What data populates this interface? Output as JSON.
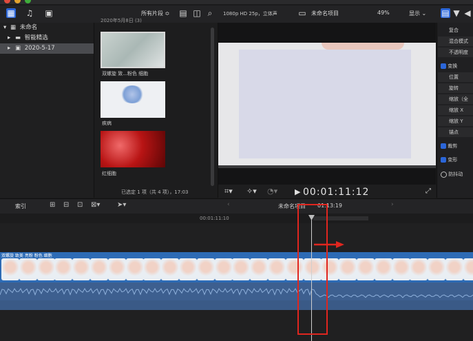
{
  "toolbar": {
    "filter_label": "所有片段 ≎",
    "viewer_format": "1080p HD 25p，立体声",
    "project_name": "未命名项目",
    "zoom": "49%",
    "display_menu": "显示 ⌄"
  },
  "library": {
    "name": "未命名",
    "items": [
      {
        "label": "智能精选"
      },
      {
        "label": "2020-5-17"
      }
    ]
  },
  "browser": {
    "date_header": "2020年5月8日 (3)",
    "clips": [
      {
        "caption": "双螺旋 致...粉色 细胞"
      },
      {
        "caption": "疾病"
      },
      {
        "caption": "红细胞"
      }
    ],
    "status": "已选定 1 项（共 4 项），17:03"
  },
  "viewer": {
    "timecode": "00:01:11:12"
  },
  "inspector": {
    "rows": [
      {
        "label": "复合"
      },
      {
        "label": "混合模式"
      },
      {
        "label": "不透明度"
      },
      {
        "label": "变换"
      },
      {
        "label": "位置"
      },
      {
        "label": "旋转"
      },
      {
        "label": "缩放（全"
      },
      {
        "label": "缩放 X"
      },
      {
        "label": "缩放 Y"
      },
      {
        "label": "锚点"
      },
      {
        "label": "裁剪"
      },
      {
        "label": "变形"
      },
      {
        "label": "防抖动"
      }
    ]
  },
  "timeline": {
    "index_label": "索引",
    "project_title": "未命名项目",
    "duration": "01:13:19",
    "ruler_time": "00:01:11:10",
    "clip_label": "双螺旋 致美 亮粉 粉色 细胞"
  },
  "colors": {
    "accent_blue": "#2d6bb5",
    "audio_blue": "#3d5f8f",
    "annotation_red": "#e0261f",
    "selection_gray": "#4a4b4f"
  }
}
